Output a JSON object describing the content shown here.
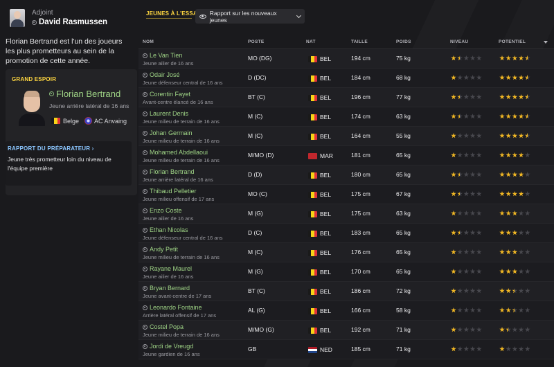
{
  "adviser": {
    "role": "Adjoint",
    "name": "David Rasmussen"
  },
  "intro": "Florian Bertrand est l'un des joueurs les plus prometteurs au sein de la promotion de cette année.",
  "prospect": {
    "title": "GRAND ESPOIR",
    "name": "Florian Bertrand",
    "description": "Jeune arrière latéral de 16 ans",
    "nationality": "Belge",
    "club": "AC Anvaing",
    "report_title": "RAPPORT DU PRÉPARATEUR",
    "report_text": "Jeune très prometteur loin du niveau de l'équipe première"
  },
  "header": {
    "tab": "JEUNES À L'ESSAI",
    "dropdown": "Rapport sur les nouveaux jeunes"
  },
  "columns": {
    "name": "NOM",
    "position": "POSTE",
    "nat": "NAT",
    "height": "TAILLE",
    "weight": "POIDS",
    "ability": "NIVEAU",
    "potential": "POTENTIEL"
  },
  "colors": {
    "accent_yellow": "#ffd740",
    "name_green": "#9fd486",
    "report_blue": "#8bc6ff",
    "star_gold": "#f2b824"
  },
  "flags": {
    "BEL": [
      "#1a1a1a",
      "#f7d417",
      "#e0323a"
    ],
    "MAR": [
      "#c1272d",
      "#c1272d",
      "#c1272d"
    ],
    "NED": [
      "#ae1c28",
      "#ffffff",
      "#21468b"
    ]
  },
  "players": [
    {
      "name": "Le Van Tien",
      "desc": "Jeune ailier de 16 ans",
      "pos": "MO (DG)",
      "nat": "BEL",
      "height": "194 cm",
      "weight": "75 kg",
      "ability": 1.5,
      "potential": 4.5
    },
    {
      "name": "Odair José",
      "desc": "Jeune défenseur central de 16 ans",
      "pos": "D (DC)",
      "nat": "BEL",
      "height": "184 cm",
      "weight": "68 kg",
      "ability": 1,
      "potential": 4.5
    },
    {
      "name": "Corentin Fayet",
      "desc": "Avant-centre élancé de 16 ans",
      "pos": "BT (C)",
      "nat": "BEL",
      "height": "196 cm",
      "weight": "77 kg",
      "ability": 1.5,
      "potential": 4.5
    },
    {
      "name": "Laurent Denis",
      "desc": "Jeune milieu de terrain de 16 ans",
      "pos": "M (C)",
      "nat": "BEL",
      "height": "174 cm",
      "weight": "63 kg",
      "ability": 1.5,
      "potential": 4.5
    },
    {
      "name": "Johan Germain",
      "desc": "Jeune milieu de terrain de 16 ans",
      "pos": "M (C)",
      "nat": "BEL",
      "height": "164 cm",
      "weight": "55 kg",
      "ability": 1,
      "potential": 4.5
    },
    {
      "name": "Mohamed Abdellaoui",
      "desc": "Jeune milieu de terrain de 16 ans",
      "pos": "M/MO (D)",
      "nat": "MAR",
      "height": "181 cm",
      "weight": "65 kg",
      "ability": 1,
      "potential": 4
    },
    {
      "name": "Florian Bertrand",
      "desc": "Jeune arrière latéral de 16 ans",
      "pos": "D (D)",
      "nat": "BEL",
      "height": "180 cm",
      "weight": "65 kg",
      "ability": 1.5,
      "potential": 4
    },
    {
      "name": "Thibaud Pelletier",
      "desc": "Jeune milieu offensif de 17 ans",
      "pos": "MO (C)",
      "nat": "BEL",
      "height": "175 cm",
      "weight": "67 kg",
      "ability": 1.5,
      "potential": 4
    },
    {
      "name": "Enzo Coste",
      "desc": "Jeune ailier de 16 ans",
      "pos": "M (G)",
      "nat": "BEL",
      "height": "175 cm",
      "weight": "63 kg",
      "ability": 1,
      "potential": 3
    },
    {
      "name": "Ethan Nicolas",
      "desc": "Jeune défenseur central de 16 ans",
      "pos": "D (C)",
      "nat": "BEL",
      "height": "183 cm",
      "weight": "65 kg",
      "ability": 1.5,
      "potential": 3
    },
    {
      "name": "Andy Petit",
      "desc": "Jeune milieu de terrain de 16 ans",
      "pos": "M (C)",
      "nat": "BEL",
      "height": "176 cm",
      "weight": "65 kg",
      "ability": 1,
      "potential": 3
    },
    {
      "name": "Rayane Maurel",
      "desc": "Jeune ailier de 16 ans",
      "pos": "M (G)",
      "nat": "BEL",
      "height": "170 cm",
      "weight": "65 kg",
      "ability": 1,
      "potential": 3
    },
    {
      "name": "Bryan Bernard",
      "desc": "Jeune avant-centre de 17 ans",
      "pos": "BT (C)",
      "nat": "BEL",
      "height": "186 cm",
      "weight": "72 kg",
      "ability": 1,
      "potential": 2.5
    },
    {
      "name": "Leonardo Fontaine",
      "desc": "Arrière latéral offensif de 17 ans",
      "pos": "AL (G)",
      "nat": "BEL",
      "height": "166 cm",
      "weight": "58 kg",
      "ability": 1,
      "potential": 2.5
    },
    {
      "name": "Costel Popa",
      "desc": "Jeune milieu de terrain de 16 ans",
      "pos": "M/MO (G)",
      "nat": "BEL",
      "height": "192 cm",
      "weight": "71 kg",
      "ability": 1,
      "potential": 1.5
    },
    {
      "name": "Jordi de Vreugd",
      "desc": "Jeune gardien de 16 ans",
      "pos": "GB",
      "nat": "NED",
      "height": "185 cm",
      "weight": "71 kg",
      "ability": 1,
      "potential": 1
    }
  ]
}
